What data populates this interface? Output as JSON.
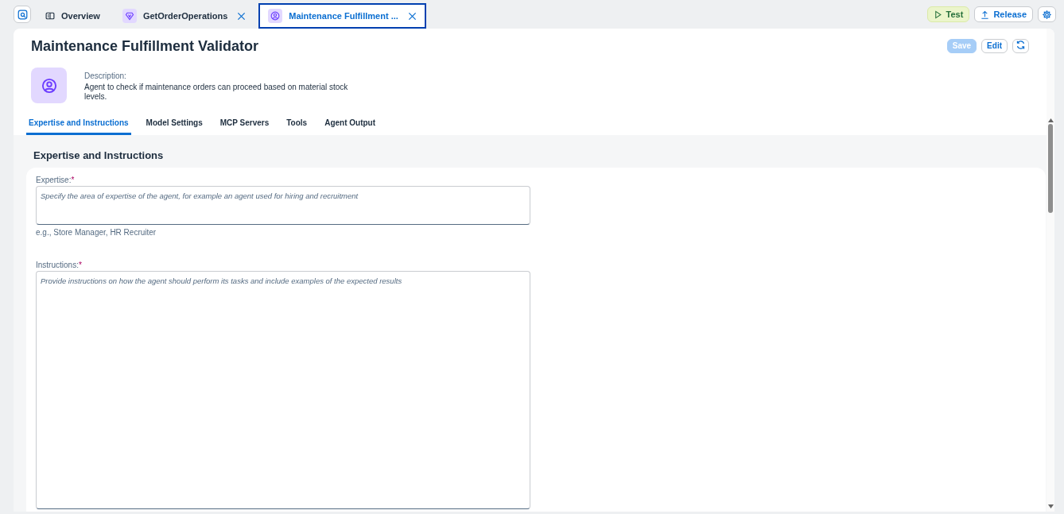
{
  "top_tabs": [
    {
      "label": "Overview",
      "kind": "overview",
      "selected": false,
      "closable": false
    },
    {
      "label": "GetOrderOperations",
      "kind": "tool",
      "selected": false,
      "closable": true
    },
    {
      "label": "Maintenance Fulfillment ...",
      "kind": "agent",
      "selected": true,
      "closable": true
    }
  ],
  "top_actions": [
    {
      "label": "Test",
      "kind": "test"
    },
    {
      "label": "Release",
      "kind": "release"
    }
  ],
  "header": {
    "title": "Maintenance Fulfillment Validator",
    "actions": [
      {
        "label": "Save",
        "disabled": true
      },
      {
        "label": "Edit",
        "disabled": false
      }
    ],
    "description_label": "Description:",
    "description": "Agent to check if maintenance orders can proceed based on material stock levels."
  },
  "tabs": [
    {
      "label": "Expertise and Instructions",
      "selected": true
    },
    {
      "label": "Model Settings",
      "selected": false
    },
    {
      "label": "MCP Servers",
      "selected": false
    },
    {
      "label": "Tools",
      "selected": false
    },
    {
      "label": "Agent Output",
      "selected": false
    }
  ],
  "section": {
    "title": "Expertise and Instructions",
    "fields": [
      {
        "label": "Expertise:",
        "required": true,
        "placeholder": "Specify the area of expertise of the agent, for example an agent used for hiring and recruitment",
        "hint": "e.g., Store Manager, HR Recruiter",
        "kind": "short",
        "required_mark": "*"
      },
      {
        "label": "Instructions:",
        "required": true,
        "placeholder": "Provide instructions on how the agent should perform its tasks and include examples of the expected results",
        "kind": "tall",
        "required_mark": "*"
      }
    ]
  }
}
